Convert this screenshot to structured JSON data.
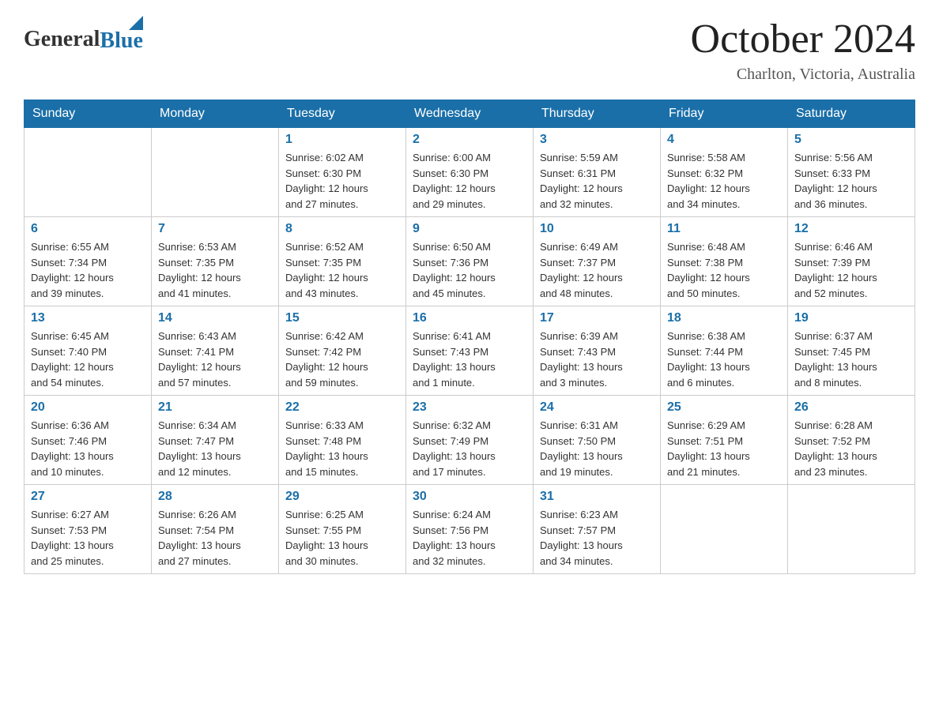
{
  "header": {
    "logo_general": "General",
    "logo_blue": "Blue",
    "month_year": "October 2024",
    "location": "Charlton, Victoria, Australia"
  },
  "days_of_week": [
    "Sunday",
    "Monday",
    "Tuesday",
    "Wednesday",
    "Thursday",
    "Friday",
    "Saturday"
  ],
  "weeks": [
    [
      {
        "day": "",
        "info": ""
      },
      {
        "day": "",
        "info": ""
      },
      {
        "day": "1",
        "info": "Sunrise: 6:02 AM\nSunset: 6:30 PM\nDaylight: 12 hours\nand 27 minutes."
      },
      {
        "day": "2",
        "info": "Sunrise: 6:00 AM\nSunset: 6:30 PM\nDaylight: 12 hours\nand 29 minutes."
      },
      {
        "day": "3",
        "info": "Sunrise: 5:59 AM\nSunset: 6:31 PM\nDaylight: 12 hours\nand 32 minutes."
      },
      {
        "day": "4",
        "info": "Sunrise: 5:58 AM\nSunset: 6:32 PM\nDaylight: 12 hours\nand 34 minutes."
      },
      {
        "day": "5",
        "info": "Sunrise: 5:56 AM\nSunset: 6:33 PM\nDaylight: 12 hours\nand 36 minutes."
      }
    ],
    [
      {
        "day": "6",
        "info": "Sunrise: 6:55 AM\nSunset: 7:34 PM\nDaylight: 12 hours\nand 39 minutes."
      },
      {
        "day": "7",
        "info": "Sunrise: 6:53 AM\nSunset: 7:35 PM\nDaylight: 12 hours\nand 41 minutes."
      },
      {
        "day": "8",
        "info": "Sunrise: 6:52 AM\nSunset: 7:35 PM\nDaylight: 12 hours\nand 43 minutes."
      },
      {
        "day": "9",
        "info": "Sunrise: 6:50 AM\nSunset: 7:36 PM\nDaylight: 12 hours\nand 45 minutes."
      },
      {
        "day": "10",
        "info": "Sunrise: 6:49 AM\nSunset: 7:37 PM\nDaylight: 12 hours\nand 48 minutes."
      },
      {
        "day": "11",
        "info": "Sunrise: 6:48 AM\nSunset: 7:38 PM\nDaylight: 12 hours\nand 50 minutes."
      },
      {
        "day": "12",
        "info": "Sunrise: 6:46 AM\nSunset: 7:39 PM\nDaylight: 12 hours\nand 52 minutes."
      }
    ],
    [
      {
        "day": "13",
        "info": "Sunrise: 6:45 AM\nSunset: 7:40 PM\nDaylight: 12 hours\nand 54 minutes."
      },
      {
        "day": "14",
        "info": "Sunrise: 6:43 AM\nSunset: 7:41 PM\nDaylight: 12 hours\nand 57 minutes."
      },
      {
        "day": "15",
        "info": "Sunrise: 6:42 AM\nSunset: 7:42 PM\nDaylight: 12 hours\nand 59 minutes."
      },
      {
        "day": "16",
        "info": "Sunrise: 6:41 AM\nSunset: 7:43 PM\nDaylight: 13 hours\nand 1 minute."
      },
      {
        "day": "17",
        "info": "Sunrise: 6:39 AM\nSunset: 7:43 PM\nDaylight: 13 hours\nand 3 minutes."
      },
      {
        "day": "18",
        "info": "Sunrise: 6:38 AM\nSunset: 7:44 PM\nDaylight: 13 hours\nand 6 minutes."
      },
      {
        "day": "19",
        "info": "Sunrise: 6:37 AM\nSunset: 7:45 PM\nDaylight: 13 hours\nand 8 minutes."
      }
    ],
    [
      {
        "day": "20",
        "info": "Sunrise: 6:36 AM\nSunset: 7:46 PM\nDaylight: 13 hours\nand 10 minutes."
      },
      {
        "day": "21",
        "info": "Sunrise: 6:34 AM\nSunset: 7:47 PM\nDaylight: 13 hours\nand 12 minutes."
      },
      {
        "day": "22",
        "info": "Sunrise: 6:33 AM\nSunset: 7:48 PM\nDaylight: 13 hours\nand 15 minutes."
      },
      {
        "day": "23",
        "info": "Sunrise: 6:32 AM\nSunset: 7:49 PM\nDaylight: 13 hours\nand 17 minutes."
      },
      {
        "day": "24",
        "info": "Sunrise: 6:31 AM\nSunset: 7:50 PM\nDaylight: 13 hours\nand 19 minutes."
      },
      {
        "day": "25",
        "info": "Sunrise: 6:29 AM\nSunset: 7:51 PM\nDaylight: 13 hours\nand 21 minutes."
      },
      {
        "day": "26",
        "info": "Sunrise: 6:28 AM\nSunset: 7:52 PM\nDaylight: 13 hours\nand 23 minutes."
      }
    ],
    [
      {
        "day": "27",
        "info": "Sunrise: 6:27 AM\nSunset: 7:53 PM\nDaylight: 13 hours\nand 25 minutes."
      },
      {
        "day": "28",
        "info": "Sunrise: 6:26 AM\nSunset: 7:54 PM\nDaylight: 13 hours\nand 27 minutes."
      },
      {
        "day": "29",
        "info": "Sunrise: 6:25 AM\nSunset: 7:55 PM\nDaylight: 13 hours\nand 30 minutes."
      },
      {
        "day": "30",
        "info": "Sunrise: 6:24 AM\nSunset: 7:56 PM\nDaylight: 13 hours\nand 32 minutes."
      },
      {
        "day": "31",
        "info": "Sunrise: 6:23 AM\nSunset: 7:57 PM\nDaylight: 13 hours\nand 34 minutes."
      },
      {
        "day": "",
        "info": ""
      },
      {
        "day": "",
        "info": ""
      }
    ]
  ]
}
